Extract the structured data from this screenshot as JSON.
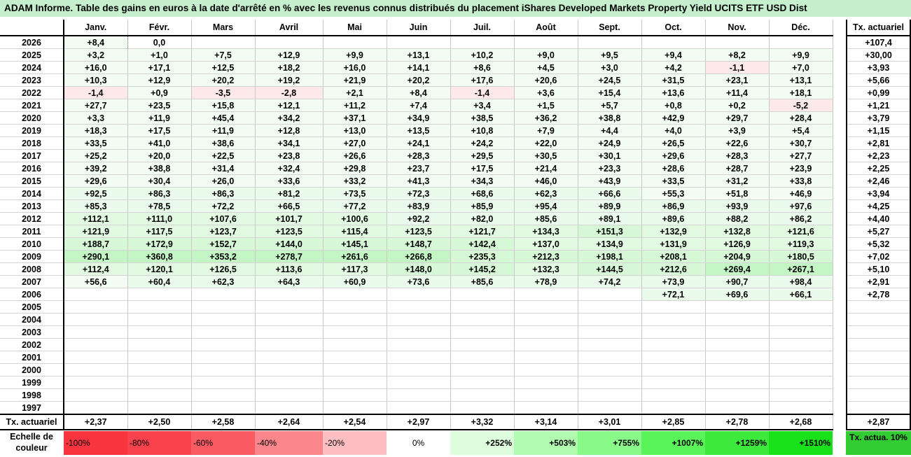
{
  "title": "ADAM Informe. Table des gains en euros à la date d'arrêté en % avec les revenus connus distribués du placement iShares Developed Markets Property Yield UCITS ETF USD Dist",
  "months": [
    "Janv.",
    "Févr.",
    "Mars",
    "Avril",
    "Mai",
    "Juin",
    "Juil.",
    "Août",
    "Sept.",
    "Oct.",
    "Nov.",
    "Déc."
  ],
  "actuarial_header": "Tx. actuariel",
  "rows": [
    {
      "year": "2026",
      "values": [
        "+8,4",
        "0,0",
        "",
        "",
        "",
        "",
        "",
        "",
        "",
        "",
        "",
        ""
      ],
      "act": "+107,4"
    },
    {
      "year": "2025",
      "values": [
        "+3,2",
        "+1,0",
        "+7,5",
        "+12,9",
        "+9,9",
        "+13,1",
        "+10,2",
        "+9,0",
        "+9,5",
        "+9,4",
        "+8,2",
        "+9,9"
      ],
      "act": "+30,00"
    },
    {
      "year": "2024",
      "values": [
        "+16,0",
        "+17,1",
        "+12,5",
        "+18,2",
        "+16,0",
        "+14,1",
        "+8,6",
        "+4,5",
        "+3,0",
        "+4,2",
        "-1,1",
        "+7,0"
      ],
      "act": "+3,93"
    },
    {
      "year": "2023",
      "values": [
        "+10,3",
        "+12,9",
        "+20,2",
        "+19,2",
        "+21,9",
        "+20,2",
        "+17,6",
        "+20,6",
        "+24,5",
        "+31,5",
        "+23,1",
        "+13,1"
      ],
      "act": "+5,66"
    },
    {
      "year": "2022",
      "values": [
        "-1,4",
        "+0,9",
        "-3,5",
        "-2,8",
        "+2,1",
        "+8,4",
        "-1,4",
        "+3,6",
        "+15,4",
        "+13,6",
        "+11,4",
        "+18,1"
      ],
      "act": "+0,99"
    },
    {
      "year": "2021",
      "values": [
        "+27,7",
        "+23,5",
        "+15,8",
        "+12,1",
        "+11,2",
        "+7,4",
        "+3,4",
        "+1,5",
        "+5,7",
        "+0,8",
        "+0,2",
        "-5,2"
      ],
      "act": "+1,21"
    },
    {
      "year": "2020",
      "values": [
        "+3,3",
        "+11,9",
        "+45,4",
        "+34,2",
        "+37,1",
        "+34,9",
        "+38,5",
        "+36,2",
        "+38,8",
        "+42,9",
        "+29,7",
        "+28,4"
      ],
      "act": "+3,79"
    },
    {
      "year": "2019",
      "values": [
        "+18,3",
        "+17,5",
        "+11,9",
        "+12,8",
        "+13,0",
        "+13,5",
        "+10,8",
        "+7,9",
        "+4,4",
        "+4,0",
        "+3,9",
        "+5,4"
      ],
      "act": "+1,15"
    },
    {
      "year": "2018",
      "values": [
        "+33,5",
        "+41,0",
        "+38,6",
        "+34,1",
        "+27,0",
        "+24,1",
        "+24,2",
        "+22,0",
        "+24,9",
        "+26,5",
        "+22,6",
        "+30,7"
      ],
      "act": "+2,81"
    },
    {
      "year": "2017",
      "values": [
        "+25,2",
        "+20,0",
        "+22,5",
        "+23,8",
        "+26,6",
        "+28,3",
        "+29,5",
        "+30,5",
        "+30,1",
        "+29,6",
        "+28,3",
        "+27,7"
      ],
      "act": "+2,23"
    },
    {
      "year": "2016",
      "values": [
        "+39,2",
        "+38,8",
        "+31,4",
        "+32,4",
        "+29,8",
        "+23,7",
        "+17,5",
        "+21,4",
        "+23,3",
        "+28,6",
        "+28,7",
        "+23,9"
      ],
      "act": "+2,25"
    },
    {
      "year": "2015",
      "values": [
        "+29,6",
        "+30,4",
        "+26,0",
        "+33,6",
        "+33,2",
        "+41,3",
        "+34,3",
        "+46,0",
        "+43,9",
        "+33,5",
        "+31,2",
        "+33,8"
      ],
      "act": "+2,46"
    },
    {
      "year": "2014",
      "values": [
        "+92,5",
        "+86,3",
        "+86,3",
        "+81,2",
        "+73,5",
        "+72,3",
        "+68,6",
        "+62,3",
        "+66,6",
        "+55,3",
        "+51,8",
        "+46,9"
      ],
      "act": "+3,94"
    },
    {
      "year": "2013",
      "values": [
        "+85,3",
        "+78,5",
        "+72,2",
        "+66,5",
        "+77,2",
        "+83,9",
        "+85,9",
        "+95,4",
        "+89,9",
        "+86,9",
        "+93,9",
        "+97,6"
      ],
      "act": "+4,25"
    },
    {
      "year": "2012",
      "values": [
        "+112,1",
        "+111,0",
        "+107,6",
        "+101,7",
        "+100,6",
        "+92,2",
        "+82,0",
        "+85,6",
        "+89,1",
        "+89,6",
        "+88,2",
        "+86,2"
      ],
      "act": "+4,40"
    },
    {
      "year": "2011",
      "values": [
        "+121,9",
        "+117,5",
        "+123,7",
        "+123,5",
        "+115,4",
        "+123,5",
        "+121,7",
        "+134,3",
        "+151,3",
        "+132,9",
        "+132,8",
        "+121,6"
      ],
      "act": "+5,27"
    },
    {
      "year": "2010",
      "values": [
        "+188,7",
        "+172,9",
        "+152,7",
        "+144,0",
        "+145,1",
        "+148,7",
        "+142,4",
        "+137,0",
        "+134,9",
        "+131,9",
        "+126,9",
        "+119,3"
      ],
      "act": "+5,32"
    },
    {
      "year": "2009",
      "values": [
        "+290,1",
        "+360,8",
        "+353,2",
        "+278,7",
        "+261,6",
        "+266,8",
        "+235,3",
        "+212,3",
        "+198,1",
        "+208,1",
        "+204,9",
        "+180,5"
      ],
      "act": "+7,02"
    },
    {
      "year": "2008",
      "values": [
        "+112,4",
        "+120,1",
        "+126,5",
        "+113,6",
        "+117,3",
        "+148,0",
        "+145,2",
        "+132,3",
        "+144,5",
        "+212,6",
        "+269,4",
        "+267,1"
      ],
      "act": "+5,10"
    },
    {
      "year": "2007",
      "values": [
        "+56,6",
        "+60,4",
        "+62,3",
        "+64,3",
        "+60,9",
        "+73,6",
        "+85,6",
        "+78,9",
        "+74,2",
        "+73,9",
        "+90,7",
        "+98,4"
      ],
      "act": "+2,91"
    },
    {
      "year": "2006",
      "values": [
        "",
        "",
        "",
        "",
        "",
        "",
        "",
        "",
        "",
        "+72,1",
        "+69,6",
        "+66,1"
      ],
      "act": "+2,78"
    },
    {
      "year": "2005",
      "values": [
        "",
        "",
        "",
        "",
        "",
        "",
        "",
        "",
        "",
        "",
        "",
        ""
      ],
      "act": ""
    },
    {
      "year": "2004",
      "values": [
        "",
        "",
        "",
        "",
        "",
        "",
        "",
        "",
        "",
        "",
        "",
        ""
      ],
      "act": ""
    },
    {
      "year": "2003",
      "values": [
        "",
        "",
        "",
        "",
        "",
        "",
        "",
        "",
        "",
        "",
        "",
        ""
      ],
      "act": ""
    },
    {
      "year": "2002",
      "values": [
        "",
        "",
        "",
        "",
        "",
        "",
        "",
        "",
        "",
        "",
        "",
        ""
      ],
      "act": ""
    },
    {
      "year": "2001",
      "values": [
        "",
        "",
        "",
        "",
        "",
        "",
        "",
        "",
        "",
        "",
        "",
        ""
      ],
      "act": ""
    },
    {
      "year": "2000",
      "values": [
        "",
        "",
        "",
        "",
        "",
        "",
        "",
        "",
        "",
        "",
        "",
        ""
      ],
      "act": ""
    },
    {
      "year": "1999",
      "values": [
        "",
        "",
        "",
        "",
        "",
        "",
        "",
        "",
        "",
        "",
        "",
        ""
      ],
      "act": ""
    },
    {
      "year": "1998",
      "values": [
        "",
        "",
        "",
        "",
        "",
        "",
        "",
        "",
        "",
        "",
        "",
        ""
      ],
      "act": ""
    },
    {
      "year": "1997",
      "values": [
        "",
        "",
        "",
        "",
        "",
        "",
        "",
        "",
        "",
        "",
        "",
        ""
      ],
      "act": ""
    }
  ],
  "footer": {
    "label": "Tx. actuariel",
    "values": [
      "+2,37",
      "+2,50",
      "+2,58",
      "+2,64",
      "+2,54",
      "+2,97",
      "+3,32",
      "+3,14",
      "+3,01",
      "+2,85",
      "+2,78",
      "+2,68"
    ],
    "act": "+2,87"
  },
  "legend": {
    "label": "Echelle de couleur",
    "items": [
      {
        "text": "-100%",
        "color": "#f8353f"
      },
      {
        "text": "-80%",
        "color": "#f9434c"
      },
      {
        "text": "-60%",
        "color": "#fa5a62"
      },
      {
        "text": "-40%",
        "color": "#fb868b"
      },
      {
        "text": "-20%",
        "color": "#fdbfc2"
      },
      {
        "text": "0%",
        "color": "#ffffff"
      },
      {
        "text": "+252%",
        "color": "#ddfddd"
      },
      {
        "text": "+503%",
        "color": "#b0fbb0"
      },
      {
        "text": "+755%",
        "color": "#89f989"
      },
      {
        "text": "+1007%",
        "color": "#5af45a"
      },
      {
        "text": "+1259%",
        "color": "#3de93d"
      },
      {
        "text": "+1510%",
        "color": "#19e119"
      }
    ],
    "actuarial": "Tx. actua. 10%",
    "actuarial_color": "#33cc33"
  },
  "colors": {
    "title_bg": "#c6efce",
    "negative_cell": "#fde9ea",
    "positive_light": "#f3fcf3",
    "positive_strong": "#c7f7c7"
  }
}
